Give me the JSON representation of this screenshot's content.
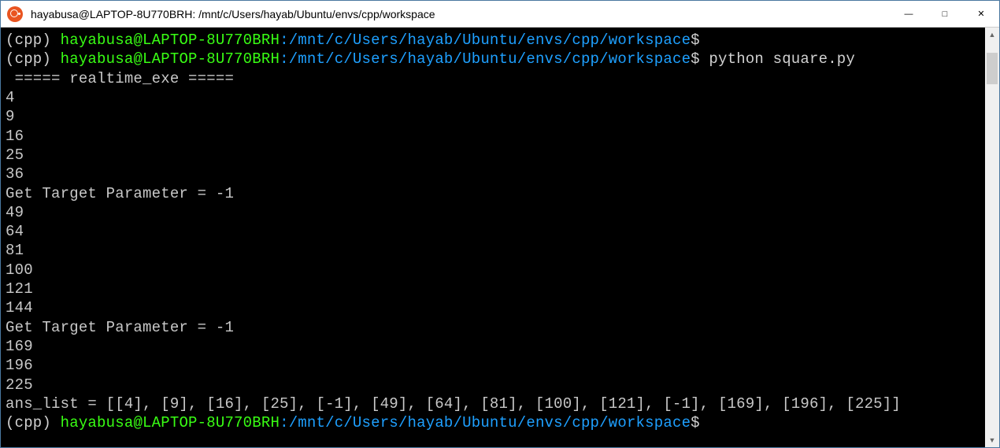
{
  "window": {
    "title": "hayabusa@LAPTOP-8U770BRH: /mnt/c/Users/hayab/Ubuntu/envs/cpp/workspace"
  },
  "prompt": {
    "env": "(cpp) ",
    "user_host": "hayabusa@LAPTOP-8U770BRH",
    "colon": ":",
    "path": "/mnt/c/Users/hayab/Ubuntu/envs/cpp/workspace",
    "dollar": "$"
  },
  "lines": {
    "command1": "",
    "command2": " python square.py",
    "header": " ===== realtime_exe =====",
    "v1": "4",
    "v2": "9",
    "v3": "16",
    "v4": "25",
    "v5": "36",
    "msg1": "Get Target Parameter = -1",
    "v6": "49",
    "v7": "64",
    "v8": "81",
    "v9": "100",
    "v10": "121",
    "v11": "144",
    "msg2": "Get Target Parameter = -1",
    "v12": "169",
    "v13": "196",
    "v14": "225",
    "ans": "ans_list = [[4], [9], [16], [25], [-1], [49], [64], [81], [100], [121], [-1], [169], [196], [225]]",
    "command3": ""
  }
}
